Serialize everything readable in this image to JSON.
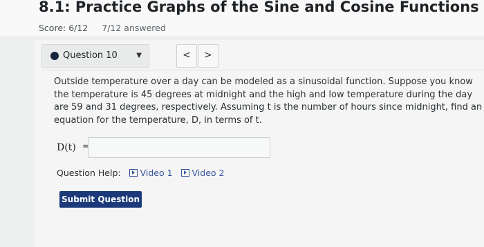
{
  "header": {
    "title": "8.1: Practice Graphs of the Sine and Cosine Functions",
    "score": "Score: 6/12",
    "answered": "7/12 answered"
  },
  "question_nav": {
    "selected": "Question 10",
    "prev_icon": "chevron-left-icon",
    "next_icon": "chevron-right-icon"
  },
  "problem": {
    "text": "Outside temperature over a day can be modeled as a sinusoidal function. Suppose you know the temperature is 45 degrees at midnight and the high and low temperature during the day are 59 and 31 degrees, respectively. Assuming t is the number of hours since midnight, find an equation for the temperature, D, in terms of t."
  },
  "answer": {
    "label": "D(t)",
    "equals": "=",
    "value": ""
  },
  "help": {
    "label": "Question Help:",
    "video1": "Video 1",
    "video2": "Video 2"
  },
  "submit": {
    "label": "Submit Question"
  },
  "colors": {
    "accent": "#1c3a7a",
    "link": "#3a55a0",
    "status_dot": "#16253f"
  }
}
